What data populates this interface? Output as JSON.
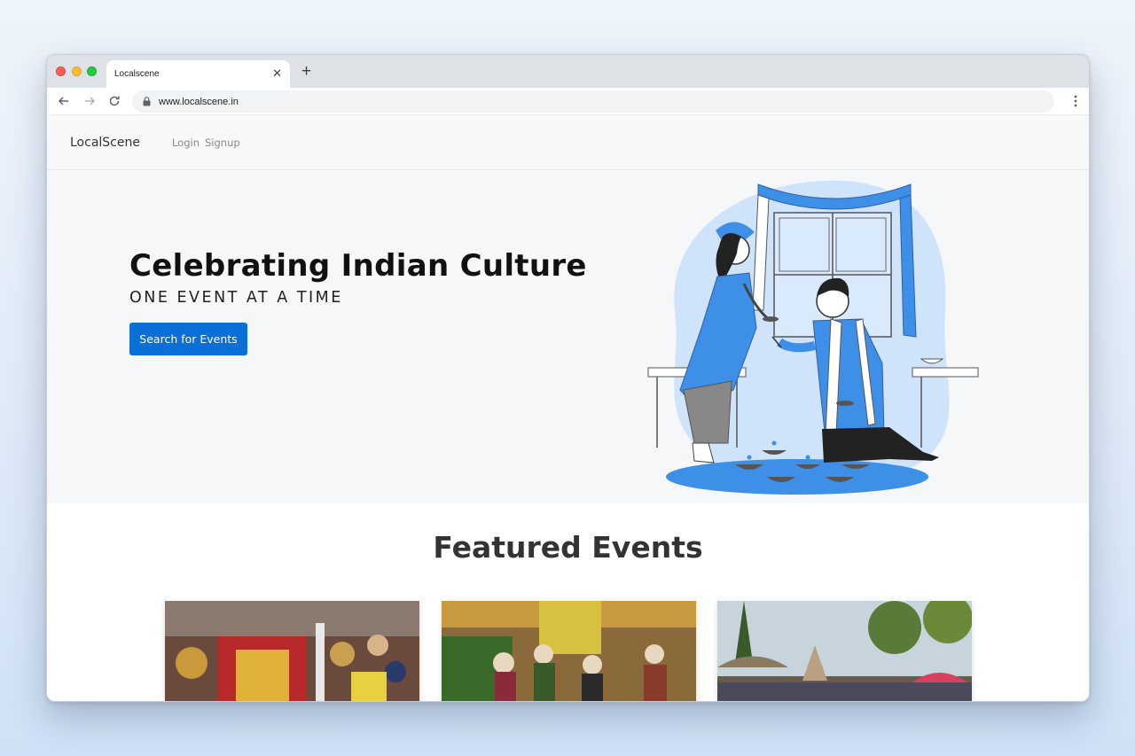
{
  "browser": {
    "tab_title": "Localscene",
    "url": "www.localscene.in"
  },
  "navbar": {
    "brand": "LocalScene",
    "links": [
      "Login",
      "Signup"
    ]
  },
  "hero": {
    "title": "Celebrating Indian Culture",
    "subtitle": "ONE EVENT AT A TIME",
    "cta_label": "Search for Events"
  },
  "featured": {
    "title": "Featured Events"
  },
  "colors": {
    "accent": "#0a6fd6",
    "illustration_blue": "#3d8fe8",
    "illustration_light": "#cfe4fb"
  },
  "icons": [
    "back-arrow-icon",
    "forward-arrow-icon",
    "reload-icon",
    "lock-icon",
    "kebab-menu-icon",
    "close-icon",
    "plus-icon"
  ]
}
